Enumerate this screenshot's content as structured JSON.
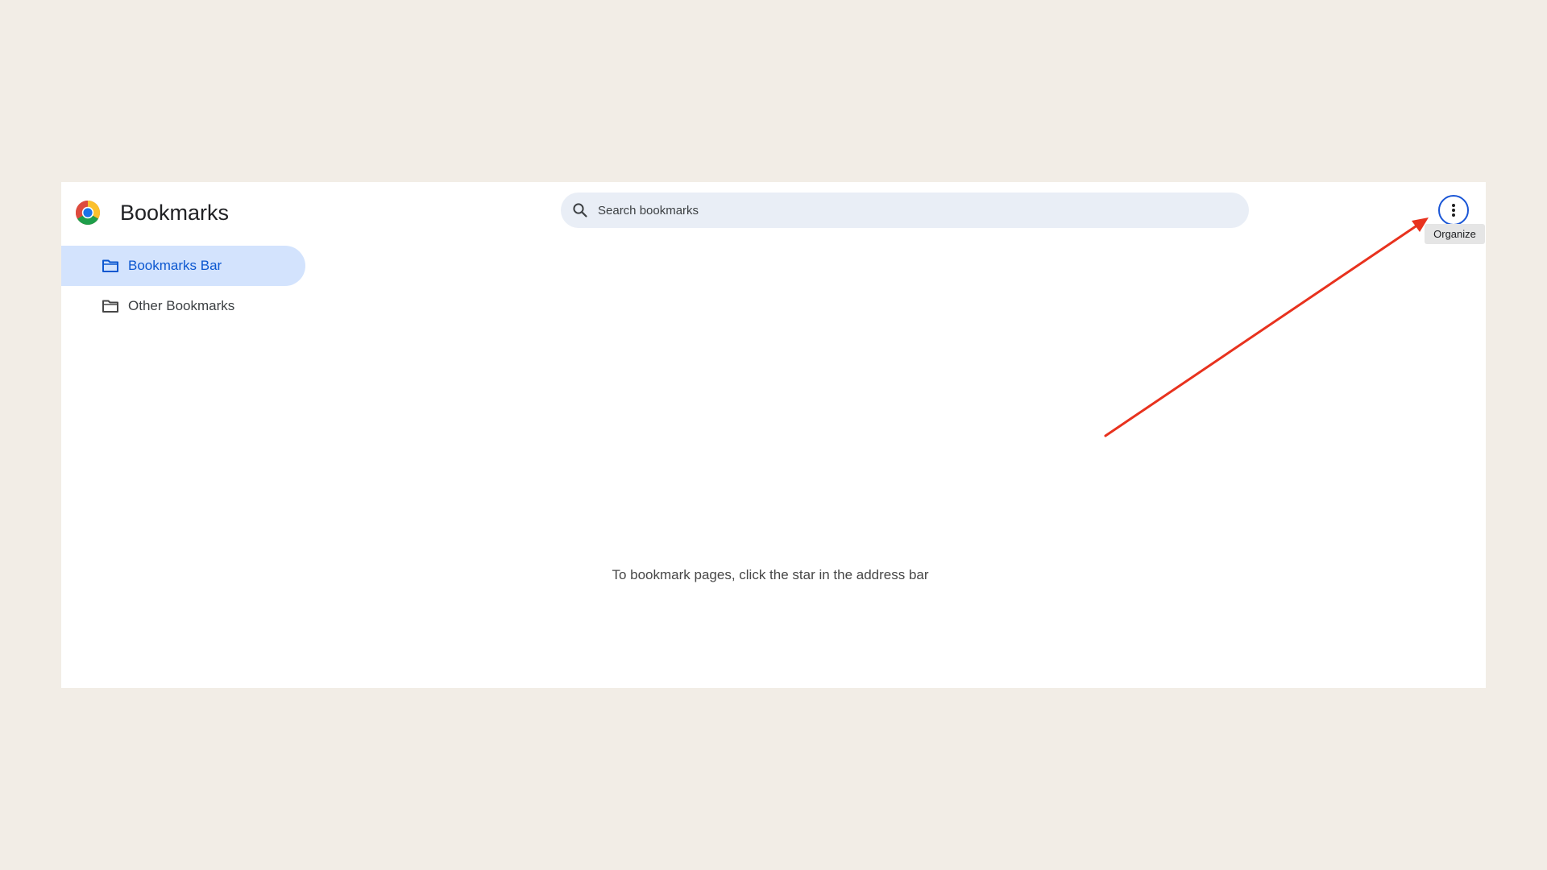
{
  "header": {
    "title": "Bookmarks",
    "logo_icon": "chrome-logo-icon"
  },
  "search": {
    "placeholder": "Search bookmarks",
    "value": "",
    "icon": "search-icon"
  },
  "menu": {
    "icon": "more-vertical-icon",
    "tooltip": "Organize"
  },
  "sidebar": {
    "items": [
      {
        "label": "Bookmarks Bar",
        "icon": "folder-icon",
        "selected": true
      },
      {
        "label": "Other Bookmarks",
        "icon": "folder-icon",
        "selected": false
      }
    ]
  },
  "main": {
    "empty_message": "To bookmark pages, click the star in the address bar"
  },
  "colors": {
    "page_background": "#f2ede6",
    "selected_item_background": "#d3e3fd",
    "selected_item_text": "#0b57d0",
    "annotation_arrow": "#e8321e",
    "focus_ring": "#1a56d6"
  }
}
